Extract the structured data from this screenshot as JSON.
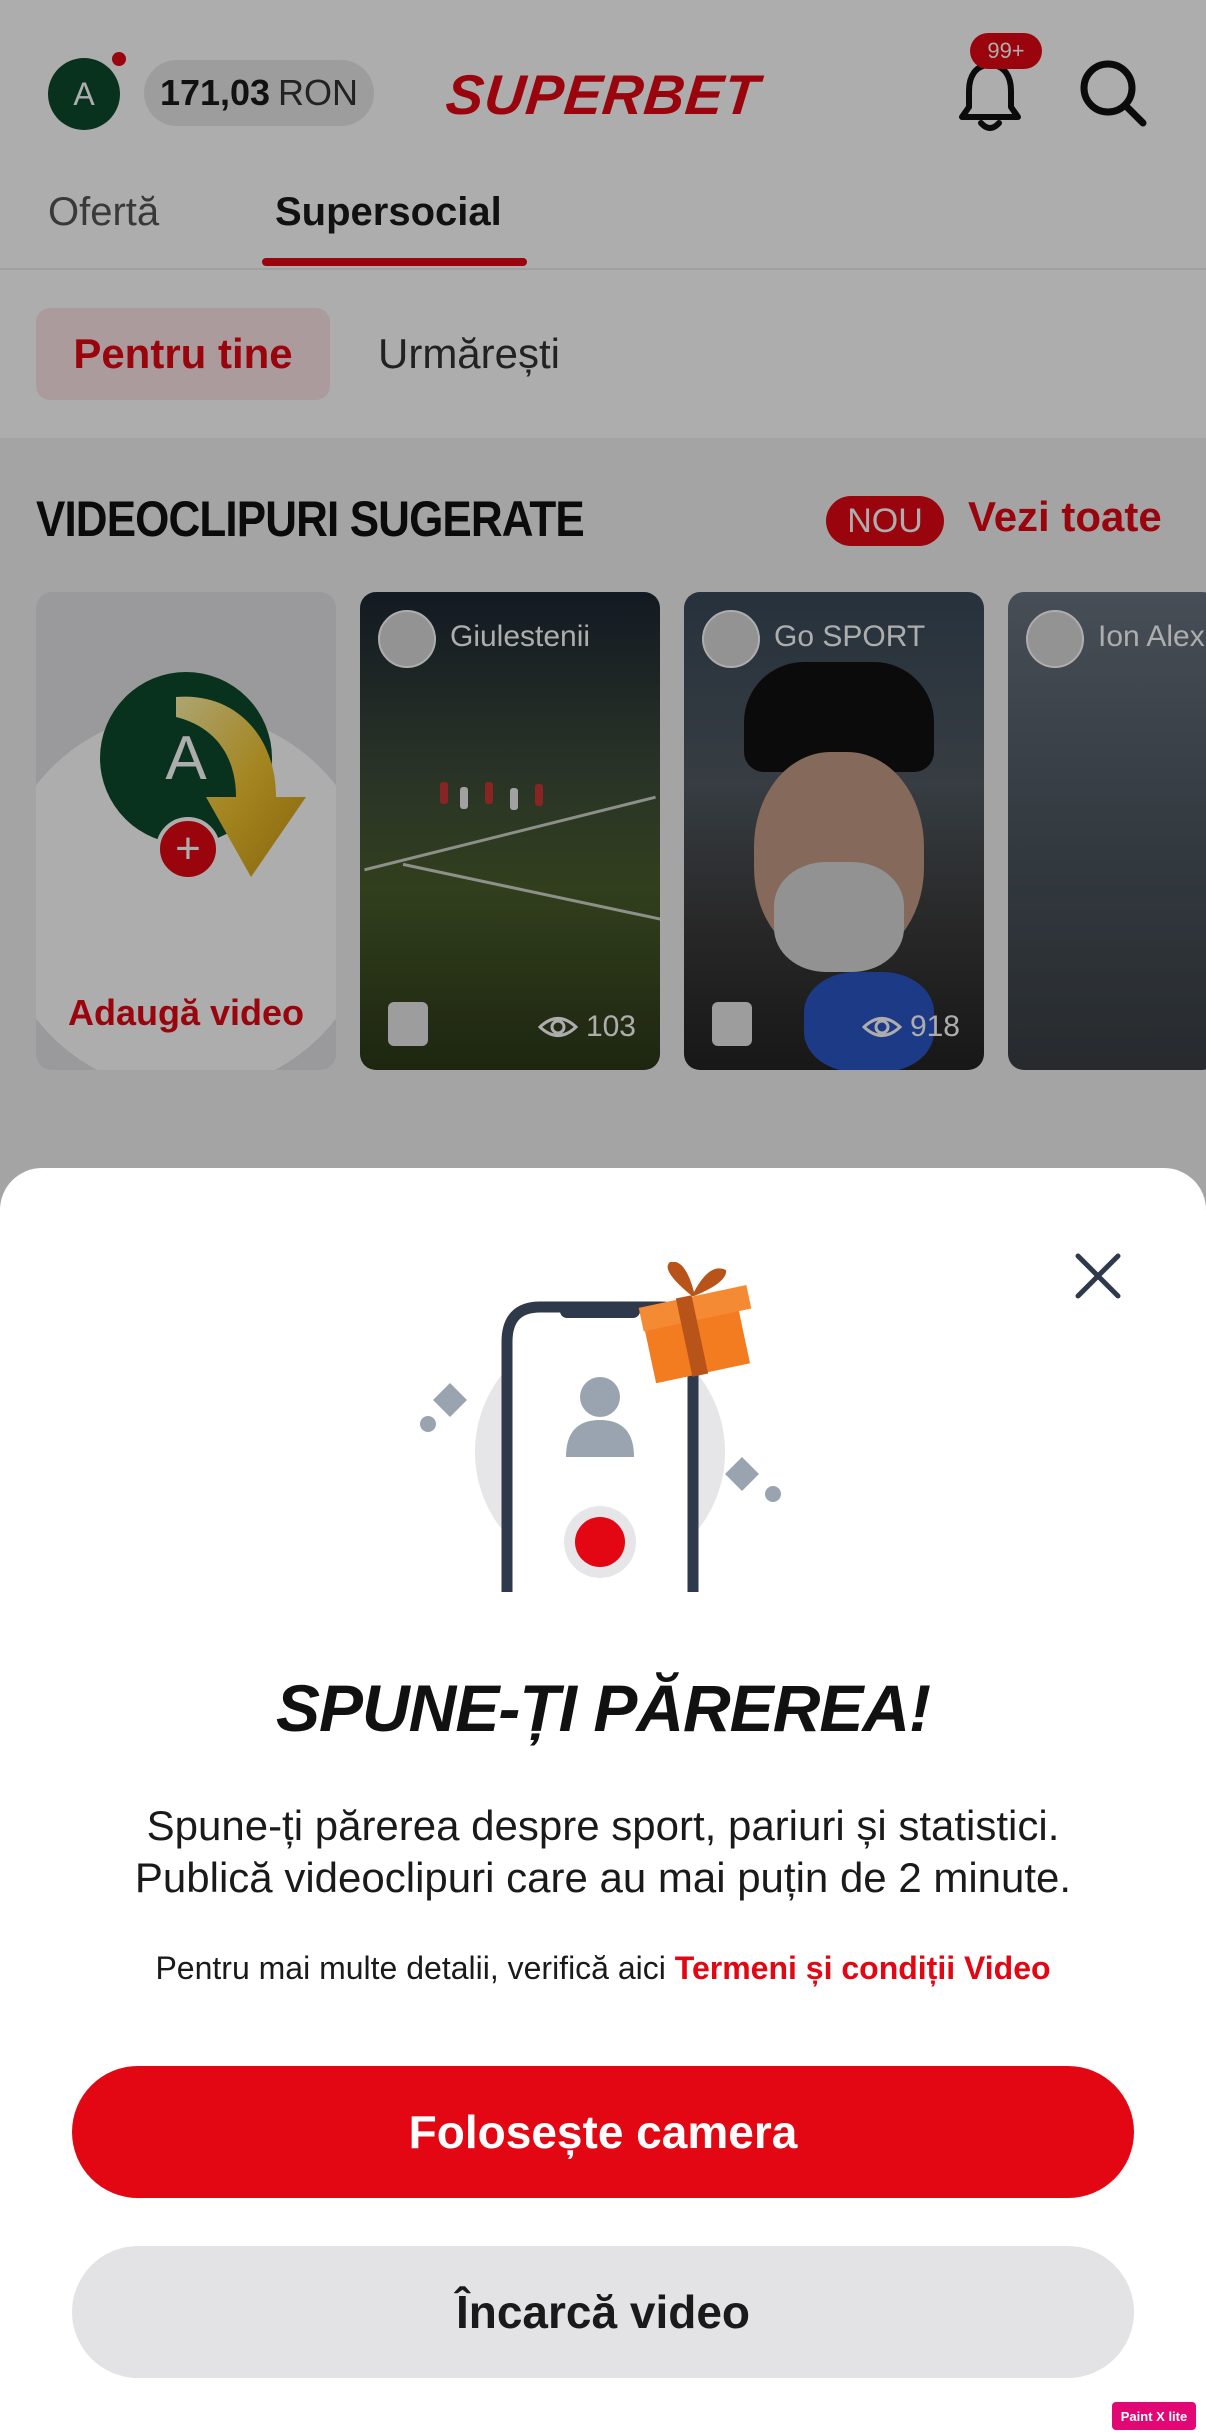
{
  "header": {
    "avatar_initial": "A",
    "balance_amount": "171,03",
    "balance_currency": "RON",
    "logo_text": "SUPERBET",
    "notifications_badge": "99+"
  },
  "tabs": [
    {
      "label": "Ofertă",
      "active": false
    },
    {
      "label": "Supersocial",
      "active": true
    }
  ],
  "subtabs": [
    {
      "label": "Pentru tine",
      "active": true
    },
    {
      "label": "Urmărești",
      "active": false
    }
  ],
  "videos_section": {
    "title": "VIDEOCLIPURI SUGERATE",
    "new_badge": "NOU",
    "see_all": "Vezi toate",
    "add_card": {
      "initial": "A",
      "label": "Adaugă video"
    },
    "cards": [
      {
        "author": "Giulestenii",
        "views": "103"
      },
      {
        "author": "Go SPORT",
        "views": "918"
      },
      {
        "author": "Ion Alex"
      }
    ]
  },
  "sheet": {
    "title": "SPUNE-ȚI PĂREREA!",
    "description_line1": "Spune-ți părerea despre sport, pariuri și statistici.",
    "description_line2": "Publică videoclipuri care au mai puțin de 2 minute.",
    "terms_prefix": "Pentru mai multe detalii, verifică aici",
    "terms_link": "Termeni și condiții Video",
    "primary_button": "Folosește camera",
    "secondary_button": "Încarcă video"
  },
  "watermark": "Paint X lite",
  "colors": {
    "brand_red": "#e30613",
    "avatar_green": "#0c4a2b",
    "gift_orange": "#f47c20"
  }
}
